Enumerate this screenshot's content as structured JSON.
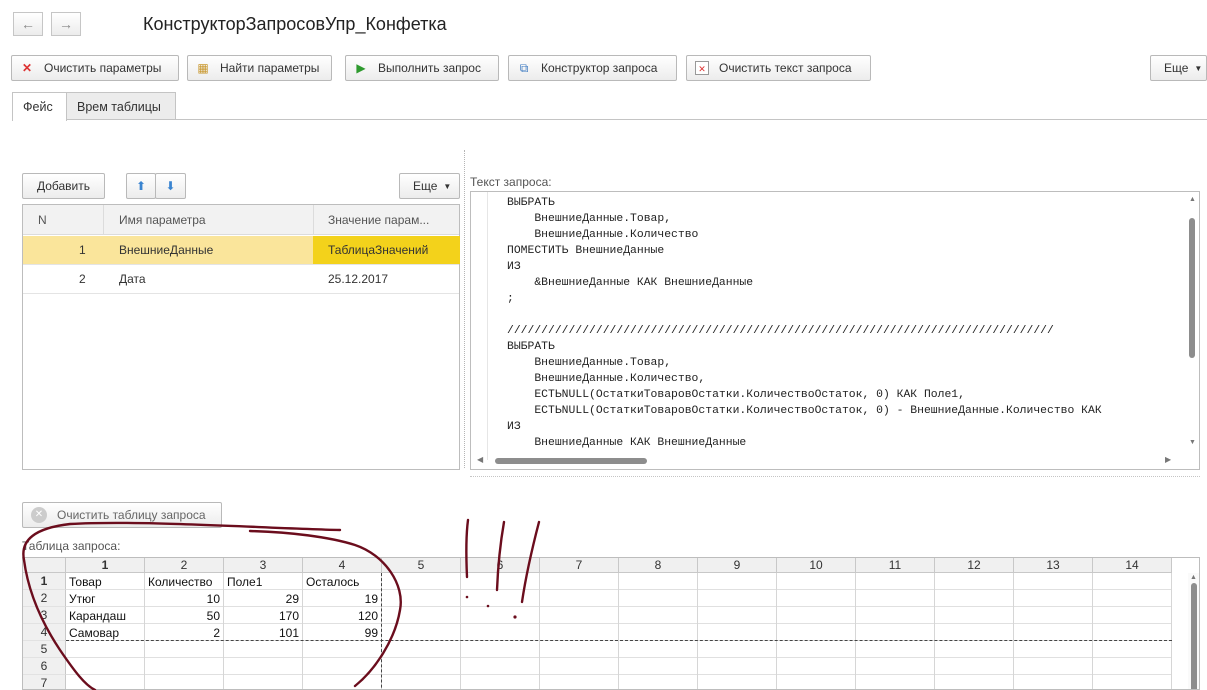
{
  "window": {
    "title": "КонструкторЗапросовУпр_Конфетка",
    "back_icon": "←",
    "forward_icon": "→"
  },
  "toolbar": {
    "clear_params": "Очистить параметры",
    "find_params": "Найти параметры",
    "run_query": "Выполнить запрос",
    "query_builder": "Конструктор запроса",
    "clear_query_text": "Очистить текст запроса",
    "more": "Еще"
  },
  "tabs": [
    "Фейс",
    "Врем таблицы"
  ],
  "params": {
    "add_label": "Добавить",
    "more": "Еще",
    "columns": [
      "N",
      "Имя параметра",
      "Значение парам..."
    ],
    "rows": [
      {
        "n": "1",
        "name": "ВнешниеДанные",
        "value": "ТаблицаЗначений"
      },
      {
        "n": "2",
        "name": "Дата",
        "value": "25.12.2017"
      }
    ]
  },
  "query": {
    "label": "Текст запроса:",
    "lines": [
      "ВЫБРАТЬ",
      "    ВнешниеДанные.Товар,",
      "    ВнешниеДанные.Количество",
      "ПОМЕСТИТЬ ВнешниеДанные",
      "ИЗ",
      "    &ВнешниеДанные КАК ВнешниеДанные",
      ";",
      "",
      "////////////////////////////////////////////////////////////////////////////////",
      "ВЫБРАТЬ",
      "    ВнешниеДанные.Товар,",
      "    ВнешниеДанные.Количество,",
      "    ЕСТЬNULL(ОстаткиТоваровОстатки.КоличествоОстаток, 0) КАК Поле1,",
      "    ЕСТЬNULL(ОстаткиТоваровОстатки.КоличествоОстаток, 0) - ВнешниеДанные.Количество КАК",
      "ИЗ",
      "    ВнешниеДанные КАК ВнешниеДанные"
    ]
  },
  "result": {
    "clear_label": "Очистить таблицу запроса",
    "label": "Таблица запроса:",
    "col_headers": [
      "1",
      "2",
      "3",
      "4",
      "5",
      "6",
      "7",
      "8",
      "9",
      "10",
      "11",
      "12",
      "13",
      "14"
    ],
    "row_headers": [
      "1",
      "2",
      "3",
      "4",
      "5",
      "6",
      "7"
    ],
    "header_row": [
      "Товар",
      "Количество",
      "Поле1",
      "Осталось"
    ],
    "rows": [
      [
        "Утюг",
        "10",
        "29",
        "19"
      ],
      [
        "Карандаш",
        "50",
        "170",
        "120"
      ],
      [
        "Самовар",
        "2",
        "101",
        "99"
      ]
    ]
  },
  "colors": {
    "selection": "#f9e38a",
    "selected_cell": "#f2d21b",
    "annotation": "#6b0d1d"
  }
}
